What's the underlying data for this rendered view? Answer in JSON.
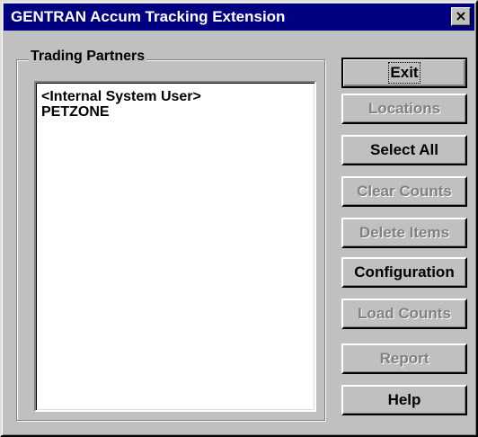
{
  "window": {
    "title": "GENTRAN Accum Tracking Extension",
    "close_glyph": "×"
  },
  "trading_partners": {
    "label": "Trading Partners",
    "items": [
      "<Internal System User>",
      "PETZONE"
    ]
  },
  "buttons": {
    "exit": "Exit",
    "locations": "Locations",
    "select_all": "Select All",
    "clear_counts": "Clear Counts",
    "delete_items": "Delete Items",
    "configuration": "Configuration",
    "load_counts": "Load Counts",
    "report": "Report",
    "help": "Help"
  },
  "colors": {
    "titlebar": "#000080",
    "face": "#c0c0c0",
    "disabled_text": "#808080"
  },
  "icons": {
    "close": "close-icon"
  }
}
